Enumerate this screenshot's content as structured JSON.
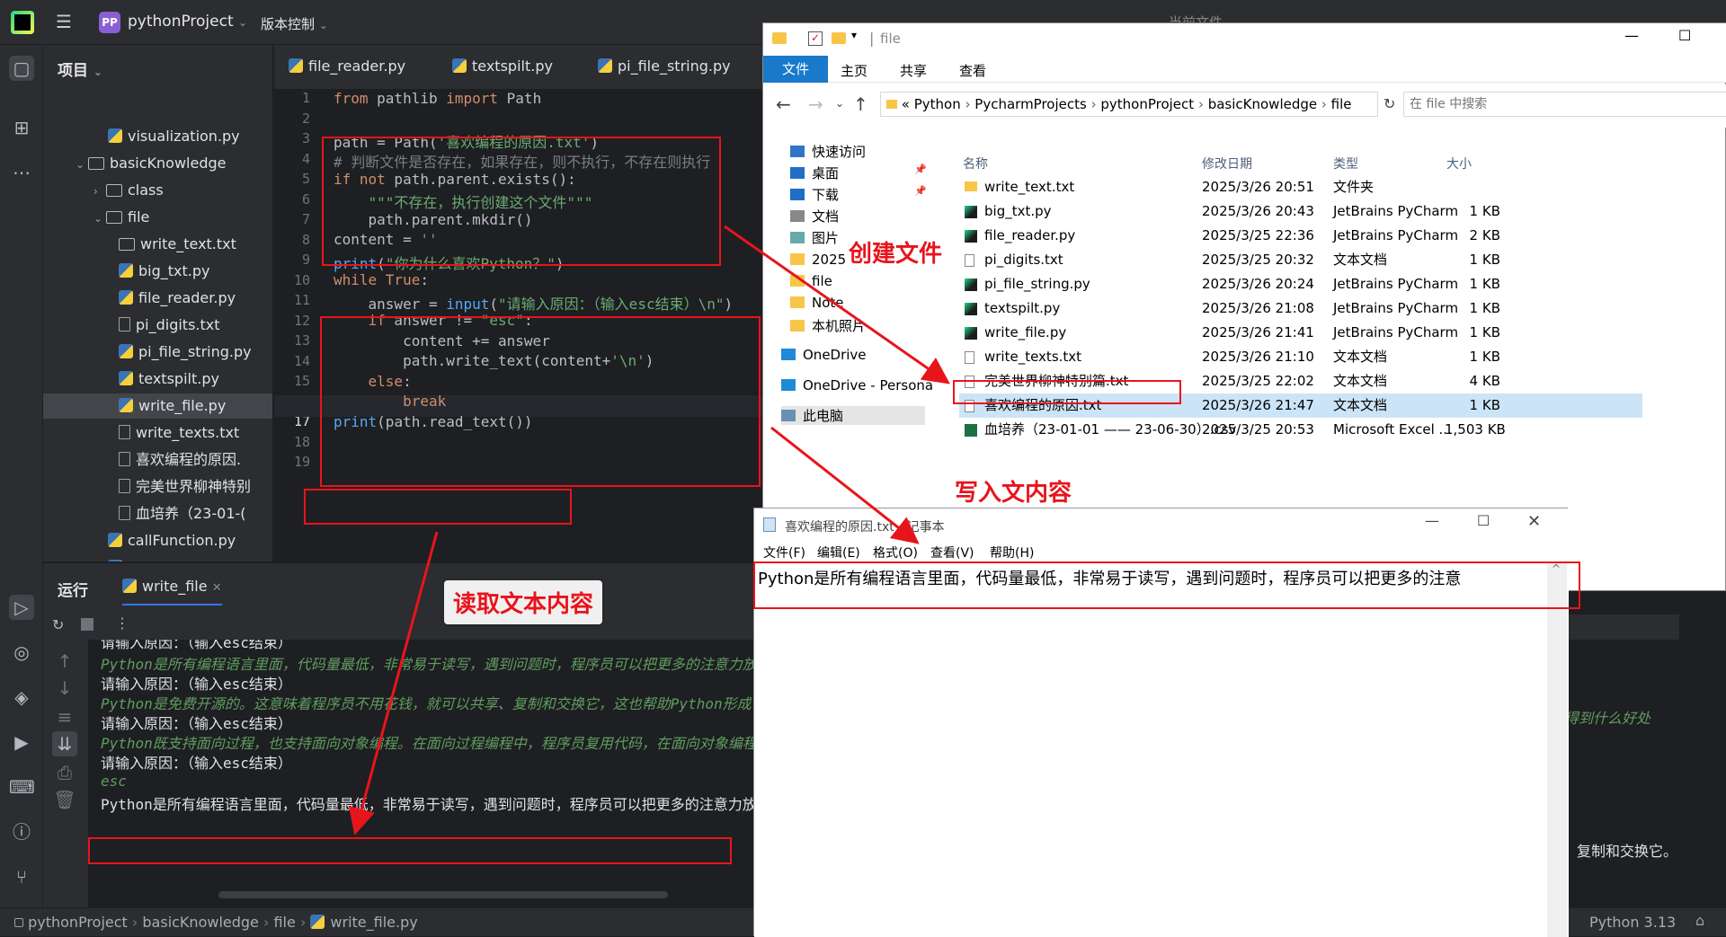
{
  "ide": {
    "project_badge": "PP",
    "project_name": "pythonProject",
    "vcs": "版本控制",
    "current_file": "当前文件",
    "panel_title": "项目",
    "tree": [
      {
        "label": "visualization.py",
        "kind": "py"
      },
      {
        "label": "basicKnowledge",
        "kind": "dir"
      },
      {
        "label": "class",
        "kind": "dir"
      },
      {
        "label": "file",
        "kind": "dir"
      },
      {
        "label": "write_text.txt",
        "kind": "dir"
      },
      {
        "label": "big_txt.py",
        "kind": "py"
      },
      {
        "label": "file_reader.py",
        "kind": "py"
      },
      {
        "label": "pi_digits.txt",
        "kind": "txt"
      },
      {
        "label": "pi_file_string.py",
        "kind": "py"
      },
      {
        "label": "textspilt.py",
        "kind": "py"
      },
      {
        "label": "write_file.py",
        "kind": "py"
      },
      {
        "label": "write_texts.txt",
        "kind": "txt"
      },
      {
        "label": "喜欢编程的原因.",
        "kind": "txt"
      },
      {
        "label": "完美世界柳神特别",
        "kind": "txt"
      },
      {
        "label": "血培养（23-01-(",
        "kind": "txt"
      },
      {
        "label": "callFunction.py",
        "kind": "py"
      },
      {
        "label": "function.py",
        "kind": "py"
      },
      {
        "label": "importFunction.py",
        "kind": "py"
      }
    ],
    "tabs": [
      "file_reader.py",
      "textspilt.py",
      "pi_file_string.py"
    ],
    "line_numbers": [
      "1",
      "2",
      "3",
      "4",
      "5",
      "6",
      "7",
      "8",
      "9",
      "10",
      "11",
      "12",
      "13",
      "14",
      "15",
      "16",
      "17",
      "18",
      "19"
    ],
    "run_title": "运行",
    "run_tab": "write_file",
    "console": [
      "请输入原因：（输入esc结束）",
      "Python是所有编程语言里面，代码量最低，非常易于读写，遇到问题时，程序员可以把更多的注意力放",
      "请输入原因：（输入esc结束）",
      "Python是免费开源的。这意味着程序员不用花钱，就可以共享、复制和交换它，这也帮助Python形成",
      "请输入原因：（输入esc结束）",
      "Python既支持面向过程，也支持面向对象编程。在面向过程编程中，程序员复用代码，在面向对象编程",
      "请输入原因：（输入esc结束）",
      "esc",
      "Python是所有编程语言里面，代码量最低，非常易于读写，遇到问题时，程序员可以把更多的注意力放"
    ],
    "console_right_1": "库会得到什么好处",
    "console_right_2": "、复制和交换它。",
    "breadcrumb": [
      "pythonProject",
      "basicKnowledge",
      "file",
      "write_file.py"
    ],
    "python_version": "Python 3.13"
  },
  "explorer": {
    "title": "file",
    "ribbon": [
      "文件",
      "主页",
      "共享",
      "查看"
    ],
    "address": [
      "«",
      "Python",
      "PycharmProjects",
      "pythonProject",
      "basicKnowledge",
      "file"
    ],
    "search_placeholder": "在 file 中搜索",
    "nav": [
      "快速访问",
      "桌面",
      "下载",
      "文档",
      "图片",
      "2025-03",
      "file",
      "Note",
      "本机照片",
      "OneDrive",
      "OneDrive - Persona",
      "此电脑"
    ],
    "columns": [
      "名称",
      "修改日期",
      "类型",
      "大小"
    ],
    "files": [
      {
        "name": "write_text.txt",
        "date": "2025/3/26 20:51",
        "type": "文件夹",
        "size": "",
        "icon": "folder"
      },
      {
        "name": "big_txt.py",
        "date": "2025/3/26 20:43",
        "type": "JetBrains PyCharm",
        "size": "1 KB",
        "icon": "pycharm"
      },
      {
        "name": "file_reader.py",
        "date": "2025/3/25 22:36",
        "type": "JetBrains PyCharm",
        "size": "2 KB",
        "icon": "pycharm"
      },
      {
        "name": "pi_digits.txt",
        "date": "2025/3/25 20:32",
        "type": "文本文档",
        "size": "1 KB",
        "icon": "txt"
      },
      {
        "name": "pi_file_string.py",
        "date": "2025/3/26 20:24",
        "type": "JetBrains PyCharm",
        "size": "1 KB",
        "icon": "pycharm"
      },
      {
        "name": "textspilt.py",
        "date": "2025/3/26 21:08",
        "type": "JetBrains PyCharm",
        "size": "1 KB",
        "icon": "pycharm"
      },
      {
        "name": "write_file.py",
        "date": "2025/3/26 21:41",
        "type": "JetBrains PyCharm",
        "size": "1 KB",
        "icon": "pycharm"
      },
      {
        "name": "write_texts.txt",
        "date": "2025/3/26 21:10",
        "type": "文本文档",
        "size": "1 KB",
        "icon": "txt"
      },
      {
        "name": "完美世界柳神特别篇.txt",
        "date": "2025/3/25 22:02",
        "type": "文本文档",
        "size": "4 KB",
        "icon": "txt"
      },
      {
        "name": "喜欢编程的原因.txt",
        "date": "2025/3/26 21:47",
        "type": "文本文档",
        "size": "1 KB",
        "icon": "txt"
      },
      {
        "name": "血培养（23-01-01 —— 23-06-30）.csv",
        "date": "2025/3/25 20:53",
        "type": "Microsoft Excel ...",
        "size": "1,503 KB",
        "icon": "excel"
      }
    ]
  },
  "notepad": {
    "title": "喜欢编程的原因.txt - 记事本",
    "menu": [
      "文件(F)",
      "编辑(E)",
      "格式(O)",
      "查看(V)",
      "帮助(H)"
    ],
    "content": "Python是所有编程语言里面，代码量最低，非常易于读写，遇到问题时，程序员可以把更多的注意"
  },
  "annotations": {
    "create": "创建文件",
    "write": "写入文内容",
    "read": "读取文本内容"
  },
  "colors": {
    "annotation_red": "#e8141c",
    "ide_bg": "#1e1f22",
    "panel_bg": "#2b2d30",
    "selection": "#cce4f7"
  }
}
